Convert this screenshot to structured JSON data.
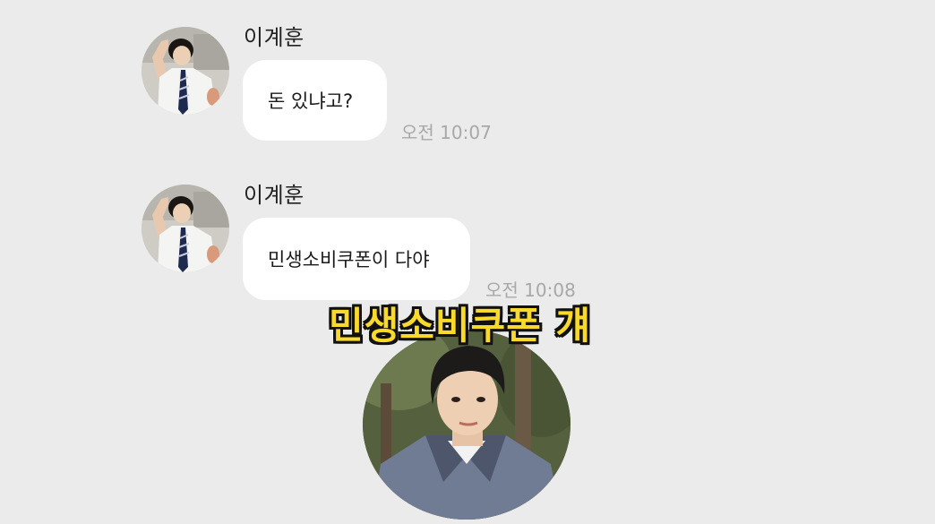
{
  "chat": {
    "messages": [
      {
        "sender": "이계훈",
        "text": "돈 있냐고?",
        "time": "오전 10:07"
      },
      {
        "sender": "이계훈",
        "text": "민생소비쿠폰이 다야",
        "time": "오전 10:08"
      }
    ]
  },
  "overlay": {
    "caption": "민생소비쿠폰 걔",
    "caption_color": "#f9d92b"
  },
  "colors": {
    "background": "#ebebeb",
    "bubble": "#ffffff",
    "timestamp": "#a8a8a8"
  },
  "icons": {
    "avatar": "profile-photo-avatar",
    "reaction": "reaction-face-photo"
  }
}
